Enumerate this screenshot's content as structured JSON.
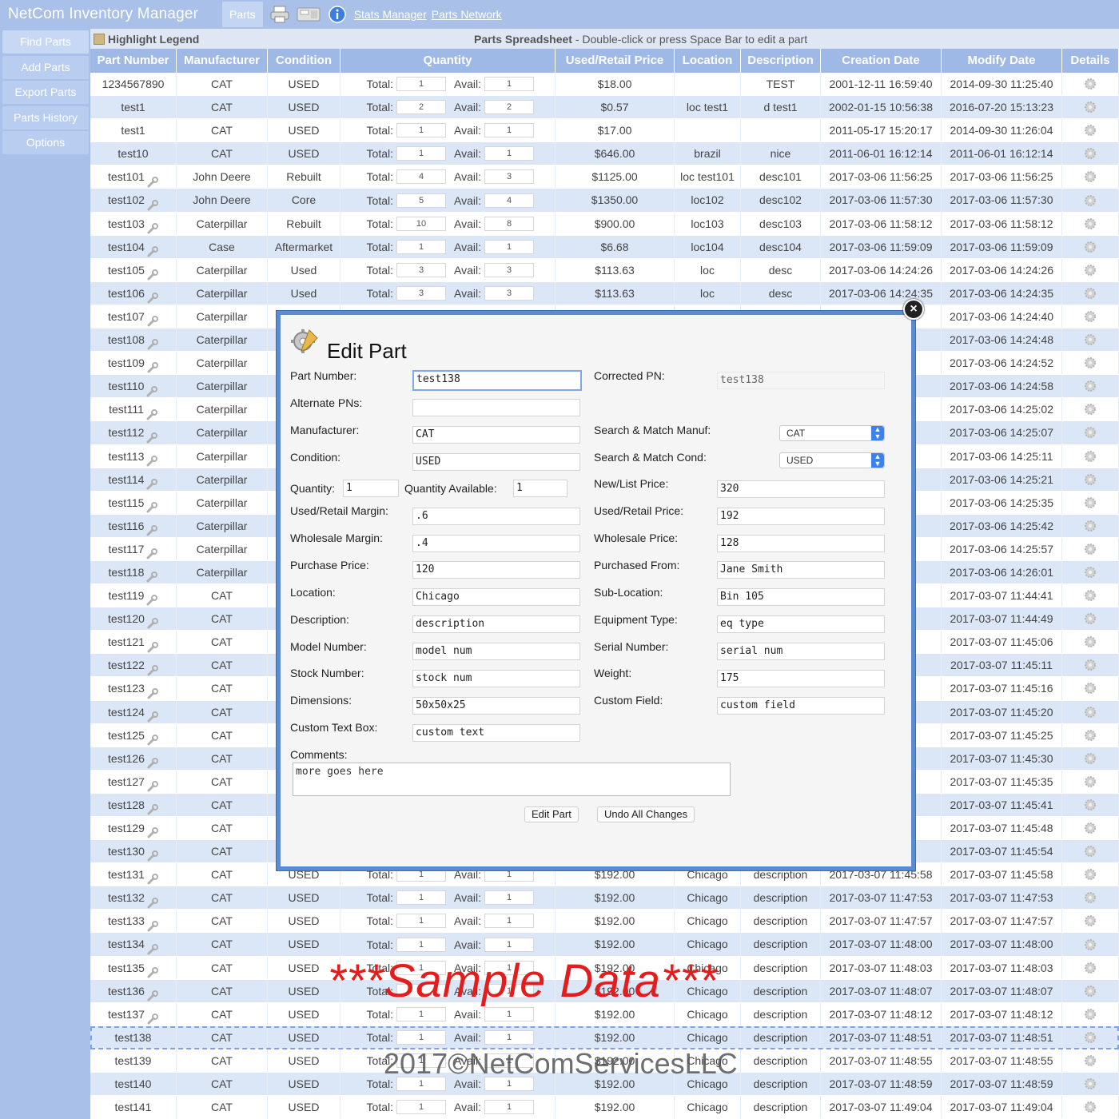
{
  "app": {
    "title": "NetCom Inventory Manager",
    "top_tab": "Parts",
    "links": [
      "Stats Manager",
      "Parts Network"
    ]
  },
  "sidebar": {
    "items": [
      {
        "label": "Find Parts"
      },
      {
        "label": "Add Parts"
      },
      {
        "label": "Export Parts"
      },
      {
        "label": "Parts History"
      },
      {
        "label": "Options"
      }
    ]
  },
  "subheader": {
    "legend": "Highlight Legend",
    "sheet_title": "Parts Spreadsheet",
    "sheet_hint": " - Double-click or press Space Bar to edit a part"
  },
  "table": {
    "headers": [
      "Part Number",
      "Manufacturer",
      "Condition",
      "Quantity",
      "Used/Retail Price",
      "Location",
      "Description",
      "Creation Date",
      "Modify Date",
      "Details"
    ],
    "total_label": "Total:",
    "avail_label": "Avail:",
    "rows": [
      {
        "pn": "1234567890",
        "mf": "CAT",
        "cond": "USED",
        "total": "1",
        "avail": "1",
        "price": "$18.00",
        "loc": "",
        "desc": "TEST",
        "cd": "2001-12-11 16:59:40",
        "md": "2014-09-30 11:25:40",
        "wrench": false
      },
      {
        "pn": "test1",
        "mf": "CAT",
        "cond": "USED",
        "total": "2",
        "avail": "2",
        "price": "$0.57",
        "loc": "loc test1",
        "desc": "d test1",
        "cd": "2002-01-15 10:56:38",
        "md": "2016-07-20 15:13:23",
        "wrench": false
      },
      {
        "pn": "test1",
        "mf": "CAT",
        "cond": "USED",
        "total": "1",
        "avail": "1",
        "price": "$17.00",
        "loc": "",
        "desc": "",
        "cd": "2011-05-17 15:20:17",
        "md": "2014-09-30 11:26:04",
        "wrench": false
      },
      {
        "pn": "test10",
        "mf": "CAT",
        "cond": "USED",
        "total": "1",
        "avail": "1",
        "price": "$646.00",
        "loc": "brazil",
        "desc": "nice",
        "cd": "2011-06-01 16:12:14",
        "md": "2011-06-01 16:12:14",
        "wrench": false
      },
      {
        "pn": "test101",
        "mf": "John Deere",
        "cond": "Rebuilt",
        "total": "4",
        "avail": "3",
        "price": "$1125.00",
        "loc": "loc test101",
        "desc": "desc101",
        "cd": "2017-03-06 11:56:25",
        "md": "2017-03-06 11:56:25",
        "wrench": true
      },
      {
        "pn": "test102",
        "mf": "John Deere",
        "cond": "Core",
        "total": "5",
        "avail": "4",
        "price": "$1350.00",
        "loc": "loc102",
        "desc": "desc102",
        "cd": "2017-03-06 11:57:30",
        "md": "2017-03-06 11:57:30",
        "wrench": true
      },
      {
        "pn": "test103",
        "mf": "Caterpillar",
        "cond": "Rebuilt",
        "total": "10",
        "avail": "8",
        "price": "$900.00",
        "loc": "loc103",
        "desc": "desc103",
        "cd": "2017-03-06 11:58:12",
        "md": "2017-03-06 11:58:12",
        "wrench": true
      },
      {
        "pn": "test104",
        "mf": "Case",
        "cond": "Aftermarket",
        "total": "1",
        "avail": "1",
        "price": "$6.68",
        "loc": "loc104",
        "desc": "desc104",
        "cd": "2017-03-06 11:59:09",
        "md": "2017-03-06 11:59:09",
        "wrench": true
      },
      {
        "pn": "test105",
        "mf": "Caterpillar",
        "cond": "Used",
        "total": "3",
        "avail": "3",
        "price": "$113.63",
        "loc": "loc",
        "desc": "desc",
        "cd": "2017-03-06 14:24:26",
        "md": "2017-03-06 14:24:26",
        "wrench": true
      },
      {
        "pn": "test106",
        "mf": "Caterpillar",
        "cond": "Used",
        "total": "3",
        "avail": "3",
        "price": "$113.63",
        "loc": "loc",
        "desc": "desc",
        "cd": "2017-03-06 14:24:35",
        "md": "2017-03-06 14:24:35",
        "wrench": true
      },
      {
        "pn": "test107",
        "mf": "Caterpillar",
        "cond": "",
        "total": "",
        "avail": "",
        "price": "",
        "loc": "",
        "desc": "",
        "cd": ":40",
        "md": "2017-03-06 14:24:40",
        "wrench": true
      },
      {
        "pn": "test108",
        "mf": "Caterpillar",
        "cond": "",
        "total": "",
        "avail": "",
        "price": "",
        "loc": "",
        "desc": "",
        "cd": ":46",
        "md": "2017-03-06 14:24:48",
        "wrench": true
      },
      {
        "pn": "test109",
        "mf": "Caterpillar",
        "cond": "",
        "total": "",
        "avail": "",
        "price": "",
        "loc": "",
        "desc": "",
        "cd": ":52",
        "md": "2017-03-06 14:24:52",
        "wrench": true
      },
      {
        "pn": "test110",
        "mf": "Caterpillar",
        "cond": "",
        "total": "",
        "avail": "",
        "price": "",
        "loc": "",
        "desc": "",
        "cd": ":58",
        "md": "2017-03-06 14:24:58",
        "wrench": true
      },
      {
        "pn": "test111",
        "mf": "Caterpillar",
        "cond": "",
        "total": "",
        "avail": "",
        "price": "",
        "loc": "",
        "desc": "",
        "cd": ":02",
        "md": "2017-03-06 14:25:02",
        "wrench": true
      },
      {
        "pn": "test112",
        "mf": "Caterpillar",
        "cond": "",
        "total": "",
        "avail": "",
        "price": "",
        "loc": "",
        "desc": "",
        "cd": ":07",
        "md": "2017-03-06 14:25:07",
        "wrench": true
      },
      {
        "pn": "test113",
        "mf": "Caterpillar",
        "cond": "",
        "total": "",
        "avail": "",
        "price": "",
        "loc": "",
        "desc": "",
        "cd": ":11",
        "md": "2017-03-06 14:25:11",
        "wrench": true
      },
      {
        "pn": "test114",
        "mf": "Caterpillar",
        "cond": "",
        "total": "",
        "avail": "",
        "price": "",
        "loc": "",
        "desc": "",
        "cd": ":21",
        "md": "2017-03-06 14:25:21",
        "wrench": true
      },
      {
        "pn": "test115",
        "mf": "Caterpillar",
        "cond": "",
        "total": "",
        "avail": "",
        "price": "",
        "loc": "",
        "desc": "",
        "cd": ":35",
        "md": "2017-03-06 14:25:35",
        "wrench": true
      },
      {
        "pn": "test116",
        "mf": "Caterpillar",
        "cond": "",
        "total": "",
        "avail": "",
        "price": "",
        "loc": "",
        "desc": "",
        "cd": ":42",
        "md": "2017-03-06 14:25:42",
        "wrench": true
      },
      {
        "pn": "test117",
        "mf": "Caterpillar",
        "cond": "",
        "total": "",
        "avail": "",
        "price": "",
        "loc": "",
        "desc": "",
        "cd": ":57",
        "md": "2017-03-06 14:25:57",
        "wrench": true
      },
      {
        "pn": "test118",
        "mf": "Caterpillar",
        "cond": "",
        "total": "",
        "avail": "",
        "price": "",
        "loc": "",
        "desc": "",
        "cd": ":01",
        "md": "2017-03-06 14:26:01",
        "wrench": true
      },
      {
        "pn": "test119",
        "mf": "CAT",
        "cond": "",
        "total": "",
        "avail": "",
        "price": "",
        "loc": "",
        "desc": "",
        "cd": ":41",
        "md": "2017-03-07 11:44:41",
        "wrench": true
      },
      {
        "pn": "test120",
        "mf": "CAT",
        "cond": "",
        "total": "",
        "avail": "",
        "price": "",
        "loc": "",
        "desc": "",
        "cd": ":49",
        "md": "2017-03-07 11:44:49",
        "wrench": true
      },
      {
        "pn": "test121",
        "mf": "CAT",
        "cond": "",
        "total": "",
        "avail": "",
        "price": "",
        "loc": "",
        "desc": "",
        "cd": ":06",
        "md": "2017-03-07 11:45:06",
        "wrench": true
      },
      {
        "pn": "test122",
        "mf": "CAT",
        "cond": "",
        "total": "",
        "avail": "",
        "price": "",
        "loc": "",
        "desc": "",
        "cd": ":11",
        "md": "2017-03-07 11:45:11",
        "wrench": true
      },
      {
        "pn": "test123",
        "mf": "CAT",
        "cond": "",
        "total": "",
        "avail": "",
        "price": "",
        "loc": "",
        "desc": "",
        "cd": ":16",
        "md": "2017-03-07 11:45:16",
        "wrench": true
      },
      {
        "pn": "test124",
        "mf": "CAT",
        "cond": "",
        "total": "",
        "avail": "",
        "price": "",
        "loc": "",
        "desc": "",
        "cd": ":20",
        "md": "2017-03-07 11:45:20",
        "wrench": true
      },
      {
        "pn": "test125",
        "mf": "CAT",
        "cond": "",
        "total": "",
        "avail": "",
        "price": "",
        "loc": "",
        "desc": "",
        "cd": ":25",
        "md": "2017-03-07 11:45:25",
        "wrench": true
      },
      {
        "pn": "test126",
        "mf": "CAT",
        "cond": "",
        "total": "",
        "avail": "",
        "price": "",
        "loc": "",
        "desc": "",
        "cd": ":30",
        "md": "2017-03-07 11:45:30",
        "wrench": true
      },
      {
        "pn": "test127",
        "mf": "CAT",
        "cond": "",
        "total": "",
        "avail": "",
        "price": "",
        "loc": "",
        "desc": "",
        "cd": ":35",
        "md": "2017-03-07 11:45:35",
        "wrench": true
      },
      {
        "pn": "test128",
        "mf": "CAT",
        "cond": "",
        "total": "",
        "avail": "",
        "price": "",
        "loc": "",
        "desc": "",
        "cd": ":41",
        "md": "2017-03-07 11:45:41",
        "wrench": true
      },
      {
        "pn": "test129",
        "mf": "CAT",
        "cond": "",
        "total": "",
        "avail": "",
        "price": "",
        "loc": "",
        "desc": "",
        "cd": ":48",
        "md": "2017-03-07 11:45:48",
        "wrench": true
      },
      {
        "pn": "test130",
        "mf": "CAT",
        "cond": "",
        "total": "",
        "avail": "",
        "price": "",
        "loc": "",
        "desc": "",
        "cd": ":54",
        "md": "2017-03-07 11:45:54",
        "wrench": true
      },
      {
        "pn": "test131",
        "mf": "CAT",
        "cond": "USED",
        "total": "1",
        "avail": "1",
        "price": "$192.00",
        "loc": "Chicago",
        "desc": "description",
        "cd": "2017-03-07 11:45:58",
        "md": "2017-03-07 11:45:58",
        "wrench": true
      },
      {
        "pn": "test132",
        "mf": "CAT",
        "cond": "USED",
        "total": "1",
        "avail": "1",
        "price": "$192.00",
        "loc": "Chicago",
        "desc": "description",
        "cd": "2017-03-07 11:47:53",
        "md": "2017-03-07 11:47:53",
        "wrench": true
      },
      {
        "pn": "test133",
        "mf": "CAT",
        "cond": "USED",
        "total": "1",
        "avail": "1",
        "price": "$192.00",
        "loc": "Chicago",
        "desc": "description",
        "cd": "2017-03-07 11:47:57",
        "md": "2017-03-07 11:47:57",
        "wrench": true
      },
      {
        "pn": "test134",
        "mf": "CAT",
        "cond": "USED",
        "total": "1",
        "avail": "1",
        "price": "$192.00",
        "loc": "Chicago",
        "desc": "description",
        "cd": "2017-03-07 11:48:00",
        "md": "2017-03-07 11:48:00",
        "wrench": true
      },
      {
        "pn": "test135",
        "mf": "CAT",
        "cond": "USED",
        "total": "1",
        "avail": "1",
        "price": "$192.00",
        "loc": "Chicago",
        "desc": "description",
        "cd": "2017-03-07 11:48:03",
        "md": "2017-03-07 11:48:03",
        "wrench": true
      },
      {
        "pn": "test136",
        "mf": "CAT",
        "cond": "USED",
        "total": "1",
        "avail": "1",
        "price": "$192.00",
        "loc": "Chicago",
        "desc": "description",
        "cd": "2017-03-07 11:48:07",
        "md": "2017-03-07 11:48:07",
        "wrench": true
      },
      {
        "pn": "test137",
        "mf": "CAT",
        "cond": "USED",
        "total": "1",
        "avail": "1",
        "price": "$192.00",
        "loc": "Chicago",
        "desc": "description",
        "cd": "2017-03-07 11:48:12",
        "md": "2017-03-07 11:48:12",
        "wrench": true
      },
      {
        "pn": "test138",
        "mf": "CAT",
        "cond": "USED",
        "total": "1",
        "avail": "1",
        "price": "$192.00",
        "loc": "Chicago",
        "desc": "description",
        "cd": "2017-03-07 11:48:51",
        "md": "2017-03-07 11:48:51",
        "wrench": false,
        "selected": true
      },
      {
        "pn": "test139",
        "mf": "CAT",
        "cond": "USED",
        "total": "1",
        "avail": "1",
        "price": "$192.00",
        "loc": "Chicago",
        "desc": "description",
        "cd": "2017-03-07 11:48:55",
        "md": "2017-03-07 11:48:55",
        "wrench": false
      },
      {
        "pn": "test140",
        "mf": "CAT",
        "cond": "USED",
        "total": "1",
        "avail": "1",
        "price": "$192.00",
        "loc": "Chicago",
        "desc": "description",
        "cd": "2017-03-07 11:48:59",
        "md": "2017-03-07 11:48:59",
        "wrench": false
      },
      {
        "pn": "test141",
        "mf": "CAT",
        "cond": "USED",
        "total": "1",
        "avail": "1",
        "price": "$192.00",
        "loc": "Chicago",
        "desc": "description",
        "cd": "2017-03-07 11:49:04",
        "md": "2017-03-07 11:49:04",
        "wrench": false
      }
    ]
  },
  "modal": {
    "title": "Edit Part",
    "labels": {
      "part_number": "Part Number:",
      "corrected_pn": "Corrected PN:",
      "alternate_pns": "Alternate PNs:",
      "manufacturer": "Manufacturer:",
      "sm_manuf": "Search & Match Manuf:",
      "condition": "Condition:",
      "sm_cond": "Search & Match Cond:",
      "quantity": "Quantity:",
      "quantity_available": "Quantity Available:",
      "new_list_price": "New/List Price:",
      "used_retail_margin": "Used/Retail Margin:",
      "used_retail_price": "Used/Retail Price:",
      "wholesale_margin": "Wholesale Margin:",
      "wholesale_price": "Wholesale Price:",
      "purchase_price": "Purchase Price:",
      "purchased_from": "Purchased From:",
      "location": "Location:",
      "sub_location": "Sub-Location:",
      "description": "Description:",
      "equipment_type": "Equipment Type:",
      "model_number": "Model Number:",
      "serial_number": "Serial Number:",
      "stock_number": "Stock Number:",
      "weight": "Weight:",
      "dimensions": "Dimensions:",
      "custom_field": "Custom Field:",
      "custom_text_box": "Custom Text Box:",
      "comments": "Comments:"
    },
    "values": {
      "part_number": "test138",
      "corrected_pn": "test138",
      "alternate_pns": "",
      "manufacturer": "CAT",
      "sm_manuf": "CAT",
      "condition": "USED",
      "sm_cond": "USED",
      "quantity": "1",
      "quantity_available": "1",
      "new_list_price": "320",
      "used_retail_margin": ".6",
      "used_retail_price": "192",
      "wholesale_margin": ".4",
      "wholesale_price": "128",
      "purchase_price": "120",
      "purchased_from": "Jane Smith",
      "location": "Chicago",
      "sub_location": "Bin 105",
      "description": "description",
      "equipment_type": "eq type",
      "model_number": "model num",
      "serial_number": "serial num",
      "stock_number": "stock num",
      "weight": "175",
      "dimensions": "50x50x25",
      "custom_field": "custom field",
      "custom_text_box": "custom text",
      "comments": "more goes here"
    },
    "buttons": {
      "edit": "Edit Part",
      "undo": "Undo All Changes"
    }
  },
  "overlay": {
    "watermark": "***Sample Data***",
    "copyright": "2017©NetComServicesLLC"
  },
  "colors": {
    "header_blue": "#9fb9e6",
    "row_alt": "#dbe6f7",
    "modal_border": "#5b8bd1",
    "watermark_red": "#e41c1c"
  }
}
